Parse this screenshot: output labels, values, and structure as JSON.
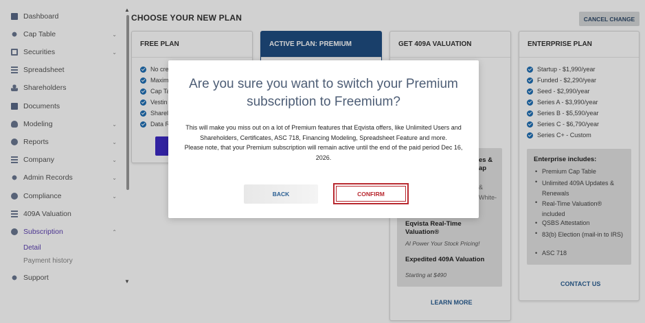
{
  "sidebar": {
    "items": [
      {
        "label": "Dashboard",
        "icon": "dashboard-icon",
        "chevron": false
      },
      {
        "label": "Cap Table",
        "icon": "cap-table-icon",
        "chevron": true
      },
      {
        "label": "Securities",
        "icon": "securities-icon",
        "chevron": true
      },
      {
        "label": "Spreadsheet",
        "icon": "spreadsheet-icon",
        "chevron": false
      },
      {
        "label": "Shareholders",
        "icon": "shareholders-icon",
        "chevron": false
      },
      {
        "label": "Documents",
        "icon": "documents-icon",
        "chevron": false
      },
      {
        "label": "Modeling",
        "icon": "modeling-icon",
        "chevron": true
      },
      {
        "label": "Reports",
        "icon": "reports-icon",
        "chevron": true
      },
      {
        "label": "Company",
        "icon": "company-icon",
        "chevron": true
      },
      {
        "label": "Admin Records",
        "icon": "admin-records-icon",
        "chevron": true
      },
      {
        "label": "Compliance",
        "icon": "compliance-icon",
        "chevron": true
      },
      {
        "label": "409A Valuation",
        "icon": "valuation-icon",
        "chevron": false
      },
      {
        "label": "Subscription",
        "icon": "subscription-icon",
        "chevron": true
      },
      {
        "label": "Support",
        "icon": "support-icon",
        "chevron": false
      }
    ],
    "subscription_sub": [
      "Detail",
      "Payment history"
    ],
    "active_sub_color": "#5b3fb0"
  },
  "page": {
    "title": "CHOOSE YOUR NEW PLAN",
    "cancel_label": "CANCEL CHANGE"
  },
  "plans": {
    "free": {
      "title": "FREE PLAN",
      "features": [
        "No cre",
        "Maxim",
        "Cap Ta",
        "Vestin",
        "Sharel",
        "Data R"
      ]
    },
    "active": {
      "title": "ACTIVE PLAN: PREMIUM"
    },
    "valuation": {
      "title": "GET 409A VALUATION",
      "partial_1": "es &",
      "partial_2": "ap",
      "partial_3": "&",
      "partial_4": "White-",
      "rt_title": "Eqvista Real-Time Valuation®",
      "rt_sub": "AI Power Your Stock Pricing!",
      "exp_title": "Expedited 409A Valuation",
      "exp_sub": "Starting at $490",
      "learn_more": "LEARN MORE"
    },
    "enterprise": {
      "title": "ENTERPRISE PLAN",
      "prices": [
        "Startup - $1,990/year",
        "Funded - $2,290/year",
        "Seed - $2,990/year",
        "Series A - $3,990/year",
        "Series B - $5,590/year",
        "Series C - $6,790/year",
        "Series C+ - Custom"
      ],
      "includes_title": "Enterprise includes:",
      "includes": [
        "Premium Cap Table",
        "Unlimited 409A Updates & Renewals",
        "Real-Time Valuation® included",
        "QSBS Attestation",
        "83(b) Election (mail-in to IRS)",
        "ASC 718"
      ],
      "contact": "CONTACT US"
    }
  },
  "modal": {
    "title": "Are you sure you want to switch your Premium subscription to Freemium?",
    "body_line1": "This will make you miss out on a lot of Premium features that Eqvista offers, like Unlimited Users and Shareholders, Certificates, ASC 718, Financing Modeling, Spreadsheet Feature and more.",
    "body_line2": "Please note, that your Premium subscription will remain active until the end of the paid period Dec 16, 2026.",
    "back_label": "BACK",
    "confirm_label": "CONFIRM"
  },
  "colors": {
    "active_plan_header": "#1f4e82",
    "confirm": "#b8282f",
    "accent_purple": "#3c2ac5"
  }
}
